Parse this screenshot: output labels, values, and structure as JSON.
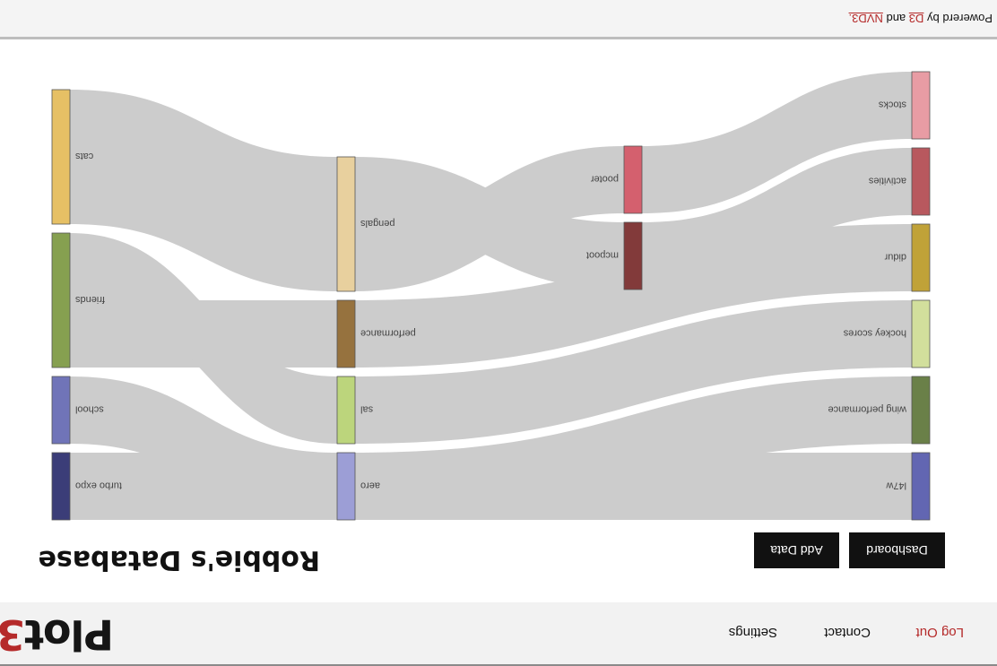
{
  "app": {
    "brand_main": "Plot",
    "brand_accent": "3",
    "accent_color": "#b52a2a"
  },
  "nav": {
    "settings": "Settings",
    "contact": "Contact",
    "logout": "Log Out"
  },
  "page": {
    "title": "Robbie's Database",
    "add_data": "Add Data",
    "dashboard": "Dashboard"
  },
  "footer": {
    "powered_prefix": "Powererd by ",
    "d3": "D3",
    "and": " and ",
    "nvd3": "NVD3."
  },
  "sankey": {
    "nodes": [
      {
        "id": "cats",
        "label": "cats",
        "column": 0,
        "color": "#e6c065"
      },
      {
        "id": "friends",
        "label": "friends",
        "column": 0,
        "color": "#86a050"
      },
      {
        "id": "school",
        "label": "school",
        "column": 0,
        "color": "#7074b8"
      },
      {
        "id": "turbo_expo",
        "label": "turbo expo",
        "column": 0,
        "color": "#3b3d78"
      },
      {
        "id": "pengals",
        "label": "pengals",
        "column": 1,
        "color": "#e8d09e"
      },
      {
        "id": "performance",
        "label": "performance",
        "column": 1,
        "color": "#96723e"
      },
      {
        "id": "sal",
        "label": "sal",
        "column": 1,
        "color": "#bcd57c"
      },
      {
        "id": "aero",
        "label": "aero",
        "column": 1,
        "color": "#9c9ed6"
      },
      {
        "id": "pooter",
        "label": "pooter",
        "column": 2,
        "color": "#d4606e"
      },
      {
        "id": "mcpoot",
        "label": "mcpoot",
        "column": 2,
        "color": "#823a3a"
      },
      {
        "id": "stocks",
        "label": "stocks",
        "column": 3,
        "color": "#e89ca4"
      },
      {
        "id": "activities",
        "label": "activities",
        "column": 3,
        "color": "#b8585e"
      },
      {
        "id": "didur",
        "label": "didur",
        "column": 3,
        "color": "#c0a238"
      },
      {
        "id": "hockey_scores",
        "label": "hockey scores",
        "column": 3,
        "color": "#d2df9c"
      },
      {
        "id": "wing_performance",
        "label": "wing performance",
        "column": 3,
        "color": "#6a8048"
      },
      {
        "id": "l47w",
        "label": "l47w",
        "column": 3,
        "color": "#6266b2"
      }
    ],
    "links": [
      {
        "source": "cats",
        "target": "pengals",
        "value": 2
      },
      {
        "source": "pengals",
        "target": "pooter",
        "value": 1
      },
      {
        "source": "pengals",
        "target": "mcpoot",
        "value": 1
      },
      {
        "source": "pooter",
        "target": "stocks",
        "value": 1
      },
      {
        "source": "mcpoot",
        "target": "activities",
        "value": 1
      },
      {
        "source": "friends",
        "target": "performance",
        "value": 1
      },
      {
        "source": "friends",
        "target": "sal",
        "value": 1
      },
      {
        "source": "performance",
        "target": "didur",
        "value": 1
      },
      {
        "source": "sal",
        "target": "hockey_scores",
        "value": 1
      },
      {
        "source": "school",
        "target": "aero",
        "value": 1
      },
      {
        "source": "aero",
        "target": "wing_performance",
        "value": 1
      },
      {
        "source": "turbo_expo",
        "target": "l47w",
        "value": 1
      }
    ],
    "link_color": "#cccccc"
  }
}
